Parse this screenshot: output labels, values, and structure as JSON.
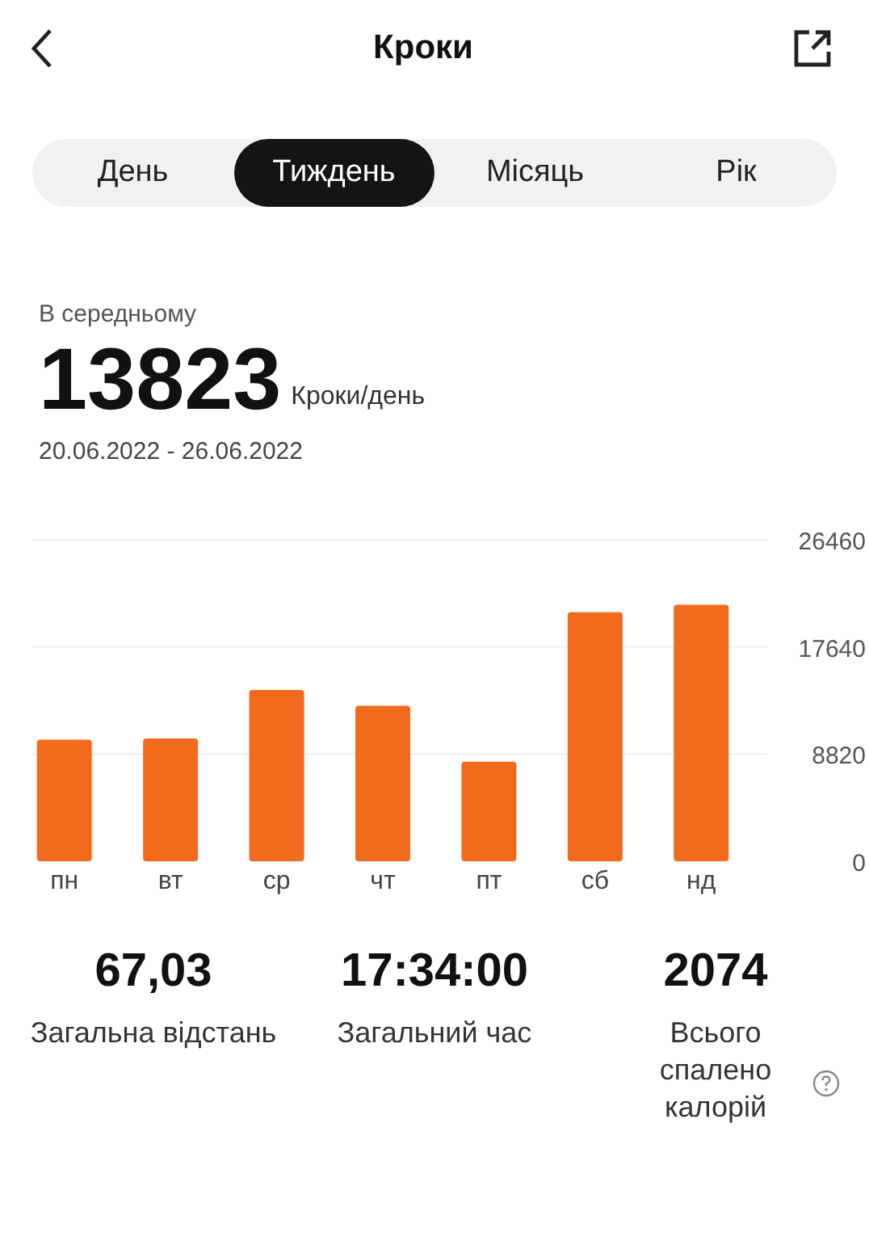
{
  "header": {
    "title": "Кроки"
  },
  "tabs": [
    {
      "label": "День",
      "selected": false
    },
    {
      "label": "Тиждень",
      "selected": true
    },
    {
      "label": "Місяць",
      "selected": false
    },
    {
      "label": "Рік",
      "selected": false
    }
  ],
  "summary": {
    "caption": "В середньому",
    "value": "13823",
    "unit": "Кроки/день",
    "range": "20.06.2022 - 26.06.2022"
  },
  "chart": {
    "chart_data": {
      "type": "bar",
      "categories": [
        "пн",
        "вт",
        "ср",
        "чт",
        "пт",
        "сб",
        "нд"
      ],
      "series": [
        {
          "color": "#f26b1d",
          "values": [
            10000,
            10100,
            14100,
            12800,
            8200,
            20500,
            21100
          ]
        }
      ],
      "ylim": [
        0,
        26460
      ],
      "yticks": [
        0,
        8820,
        17640,
        26460
      ]
    }
  },
  "stats": [
    {
      "value": "67,03",
      "label": "Загальна відстань",
      "help": false
    },
    {
      "value": "17:34:00",
      "label": "Загальний час",
      "help": false
    },
    {
      "value": "2074",
      "label": "Всього спалено калорій",
      "help": true
    }
  ]
}
